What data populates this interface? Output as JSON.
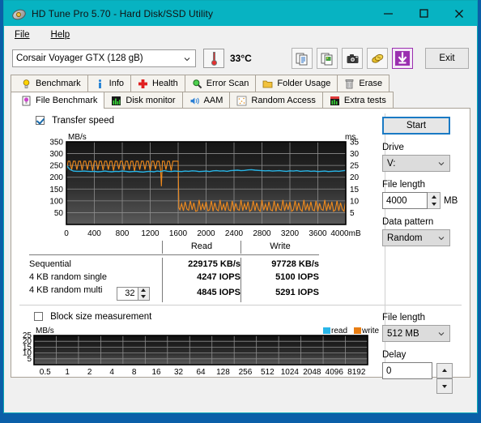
{
  "window": {
    "title": "HD Tune Pro 5.70 - Hard Disk/SSD Utility",
    "icon": "hard-disk-icon",
    "minimize": "—",
    "maximize": "□",
    "close": "✕"
  },
  "menu": [
    {
      "label": "File",
      "accel": "F"
    },
    {
      "label": "Help",
      "accel": "H"
    }
  ],
  "toolbar": {
    "drive": "Corsair Voyager GTX (128 gB)",
    "temperature": "33°C",
    "icons": [
      "copy-text-icon",
      "copy-image-icon",
      "screenshot-camera-icon",
      "coins-icon",
      "download-arrow-icon"
    ],
    "exit_label": "Exit"
  },
  "tabs_row1": [
    {
      "label": "Benchmark",
      "icon": "lightbulb-icon",
      "active": false
    },
    {
      "label": "Info",
      "icon": "info-icon",
      "active": false
    },
    {
      "label": "Health",
      "icon": "red-cross-icon",
      "active": false
    },
    {
      "label": "Error Scan",
      "icon": "magnifier-icon",
      "active": false
    },
    {
      "label": "Folder Usage",
      "icon": "folder-icon",
      "active": false
    },
    {
      "label": "Erase",
      "icon": "trash-icon",
      "active": false
    }
  ],
  "tabs_row2": [
    {
      "label": "File Benchmark",
      "icon": "file-benchmark-icon",
      "active": true
    },
    {
      "label": "Disk monitor",
      "icon": "bar-chart-icon",
      "active": false
    },
    {
      "label": "AAM",
      "icon": "speaker-icon",
      "active": false
    },
    {
      "label": "Random Access",
      "icon": "random-access-icon",
      "active": false
    },
    {
      "label": "Extra tests",
      "icon": "extra-tests-icon",
      "active": false
    }
  ],
  "transfer": {
    "checkbox_label": "Transfer speed",
    "checked": true
  },
  "results": {
    "columns": [
      "",
      "Read",
      "Write"
    ],
    "rows": [
      {
        "name": "Sequential",
        "read": "229175 KB/s",
        "write": "97728 KB/s"
      },
      {
        "name": "4 KB random single",
        "read": "4247 IOPS",
        "write": "5100 IOPS"
      },
      {
        "name": "4 KB random multi",
        "read": "4845 IOPS",
        "write": "5291 IOPS"
      }
    ],
    "queue_depth": "32"
  },
  "panel_top": {
    "start_label": "Start",
    "drive_label": "Drive",
    "drive_value": "V:",
    "file_length_label": "File length",
    "file_length_value": "4000",
    "file_length_unit": "MB",
    "data_pattern_label": "Data pattern",
    "data_pattern_value": "Random"
  },
  "block": {
    "checkbox_label": "Block size measurement",
    "checked": false,
    "legend": [
      {
        "label": "read",
        "color": "#29b6e8"
      },
      {
        "label": "write",
        "color": "#e87d12"
      }
    ]
  },
  "panel_bottom": {
    "file_length_label": "File length",
    "file_length_value": "512 MB",
    "delay_label": "Delay",
    "delay_value": "0"
  },
  "colors": {
    "titlebar": "#07b3c2",
    "read": "#29b6e8",
    "write": "#f08a1c",
    "accent": "#1a7ac4",
    "graph_bg_top": "#161616",
    "graph_bg_bottom": "#4a4a4a"
  },
  "chart_data": {
    "type": "line",
    "title": "Transfer speed",
    "xlabel": "mB",
    "ylabel": "MB/s",
    "y2label": "ms",
    "xlim": [
      0,
      4000
    ],
    "ylim": [
      0,
      350
    ],
    "y2lim": [
      0,
      35
    ],
    "xticks": [
      0,
      400,
      800,
      1200,
      1600,
      2000,
      2400,
      2800,
      3200,
      3600,
      4000
    ],
    "yticks": [
      50,
      100,
      150,
      200,
      250,
      300,
      350
    ],
    "y2ticks": [
      5,
      10,
      15,
      20,
      25,
      30,
      35
    ],
    "grid": true,
    "legend": [
      "read",
      "write"
    ],
    "series": [
      {
        "name": "write",
        "color": "#f08a1c",
        "axis": "left",
        "note": "oscillates 225-270 MB/s until ~1600 mB then drops to 55-105 MB/s band",
        "x": [
          0,
          25,
          50,
          75,
          100,
          125,
          150,
          175,
          200,
          225,
          250,
          275,
          300,
          325,
          350,
          375,
          400,
          425,
          450,
          475,
          500,
          525,
          550,
          575,
          600,
          625,
          650,
          675,
          700,
          725,
          750,
          775,
          800,
          825,
          850,
          875,
          900,
          925,
          950,
          975,
          1000,
          1025,
          1050,
          1075,
          1100,
          1125,
          1150,
          1175,
          1200,
          1225,
          1250,
          1275,
          1300,
          1325,
          1350,
          1360,
          1375,
          1400,
          1425,
          1450,
          1475,
          1500,
          1525,
          1550,
          1575,
          1600,
          1610,
          1625,
          1650,
          1675,
          1700,
          1725,
          1750,
          1775,
          1800,
          1825,
          1850,
          1875,
          1900,
          1925,
          1950,
          1975,
          2000,
          2025,
          2050,
          2075,
          2100,
          2125,
          2150,
          2175,
          2200,
          2225,
          2250,
          2275,
          2300,
          2325,
          2350,
          2375,
          2400,
          2425,
          2450,
          2475,
          2500,
          2525,
          2550,
          2575,
          2600,
          2625,
          2650,
          2675,
          2700,
          2725,
          2750,
          2775,
          2800,
          2825,
          2850,
          2875,
          2900,
          2925,
          2950,
          2975,
          3000,
          3025,
          3050,
          3075,
          3100,
          3125,
          3150,
          3175,
          3200,
          3225,
          3250,
          3275,
          3300,
          3325,
          3350,
          3375,
          3400,
          3425,
          3450,
          3475,
          3500,
          3525,
          3550,
          3575,
          3600,
          3625,
          3650,
          3675,
          3700,
          3725,
          3750,
          3775,
          3800,
          3825,
          3850,
          3875,
          3900,
          3925,
          3950,
          3975,
          4000
        ],
        "y": [
          225,
          268,
          268,
          232,
          268,
          268,
          232,
          268,
          268,
          230,
          268,
          268,
          232,
          268,
          268,
          228,
          268,
          268,
          232,
          268,
          268,
          230,
          268,
          268,
          232,
          268,
          268,
          228,
          268,
          268,
          234,
          268,
          268,
          230,
          268,
          268,
          232,
          268,
          268,
          226,
          268,
          268,
          232,
          268,
          268,
          232,
          268,
          268,
          228,
          268,
          268,
          234,
          268,
          268,
          230,
          162,
          268,
          268,
          232,
          268,
          268,
          228,
          268,
          268,
          268,
          268,
          70,
          62,
          88,
          58,
          96,
          66,
          60,
          100,
          62,
          92,
          56,
          58,
          104,
          60,
          88,
          62,
          96,
          58,
          62,
          100,
          56,
          92,
          64,
          58,
          104,
          60,
          86,
          58,
          96,
          62,
          58,
          100,
          56,
          90,
          64,
          60,
          104,
          58,
          88,
          62,
          96,
          56,
          62,
          100,
          58,
          92,
          64,
          56,
          104,
          60,
          86,
          58,
          96,
          62,
          58,
          100,
          56,
          90,
          64,
          60,
          104,
          58,
          88,
          62,
          96,
          56,
          62,
          100,
          58,
          92,
          64,
          56,
          104,
          60,
          86,
          58,
          96,
          62,
          58,
          100,
          56,
          90,
          64,
          60,
          104,
          58,
          88,
          62,
          96,
          56,
          62,
          100,
          58,
          92,
          64,
          56,
          104
        ]
      },
      {
        "name": "read",
        "color": "#29b6e8",
        "axis": "right",
        "note": "access time roughly flat at 22-23 ms across the whole run",
        "x": [
          0,
          50,
          100,
          150,
          200,
          250,
          300,
          350,
          400,
          450,
          500,
          550,
          600,
          650,
          700,
          750,
          800,
          850,
          900,
          950,
          1000,
          1050,
          1100,
          1150,
          1200,
          1250,
          1300,
          1350,
          1400,
          1450,
          1500,
          1550,
          1600,
          1650,
          1700,
          1750,
          1800,
          1850,
          1900,
          1950,
          2000,
          2050,
          2100,
          2150,
          2200,
          2250,
          2300,
          2350,
          2400,
          2450,
          2500,
          2550,
          2600,
          2650,
          2700,
          2750,
          2800,
          2850,
          2900,
          2950,
          3000,
          3050,
          3100,
          3150,
          3200,
          3250,
          3300,
          3350,
          3400,
          3450,
          3500,
          3550,
          3600,
          3650,
          3700,
          3750,
          3800,
          3850,
          3900,
          3950,
          4000
        ],
        "y": [
          25.0,
          23.3,
          22.6,
          22.5,
          22.5,
          22.6,
          22.5,
          22.4,
          22.5,
          22.3,
          22.4,
          22.6,
          22.4,
          22.3,
          22.5,
          22.4,
          22.6,
          22.5,
          22.3,
          22.4,
          22.5,
          22.3,
          22.2,
          22.4,
          22.5,
          22.3,
          22.6,
          22.4,
          22.8,
          22.5,
          22.4,
          22.6,
          22.5,
          22.4,
          22.6,
          22.5,
          22.7,
          22.6,
          22.4,
          22.5,
          22.6,
          22.4,
          22.7,
          22.8,
          22.6,
          22.7,
          22.5,
          22.8,
          22.9,
          23.0,
          22.8,
          22.9,
          23.1,
          23.2,
          23.0,
          22.9,
          22.8,
          22.7,
          22.8,
          22.6,
          22.7,
          22.8,
          22.6,
          22.5,
          22.7,
          22.6,
          22.8,
          22.5,
          22.6,
          22.7,
          22.5,
          22.6,
          22.4,
          22.5,
          22.6,
          22.4,
          22.5,
          22.6,
          22.5,
          22.7,
          22.9
        ]
      }
    ]
  },
  "chart_data_block": {
    "type": "line",
    "title": "Block size measurement",
    "xlabel": "",
    "ylabel": "MB/s",
    "xlim": [
      0.5,
      8192
    ],
    "ylim": [
      0,
      25
    ],
    "xticks": [
      "0.5",
      "1",
      "2",
      "4",
      "8",
      "16",
      "32",
      "64",
      "128",
      "256",
      "512",
      "1024",
      "2048",
      "4096",
      "8192"
    ],
    "yticks": [
      5,
      10,
      15,
      20,
      25
    ],
    "grid": true,
    "legend": [
      "read",
      "write"
    ],
    "series": [
      {
        "name": "read",
        "color": "#29b6e8",
        "x": [],
        "y": []
      },
      {
        "name": "write",
        "color": "#e87d12",
        "x": [],
        "y": []
      }
    ],
    "note": "empty - no data plotted"
  }
}
